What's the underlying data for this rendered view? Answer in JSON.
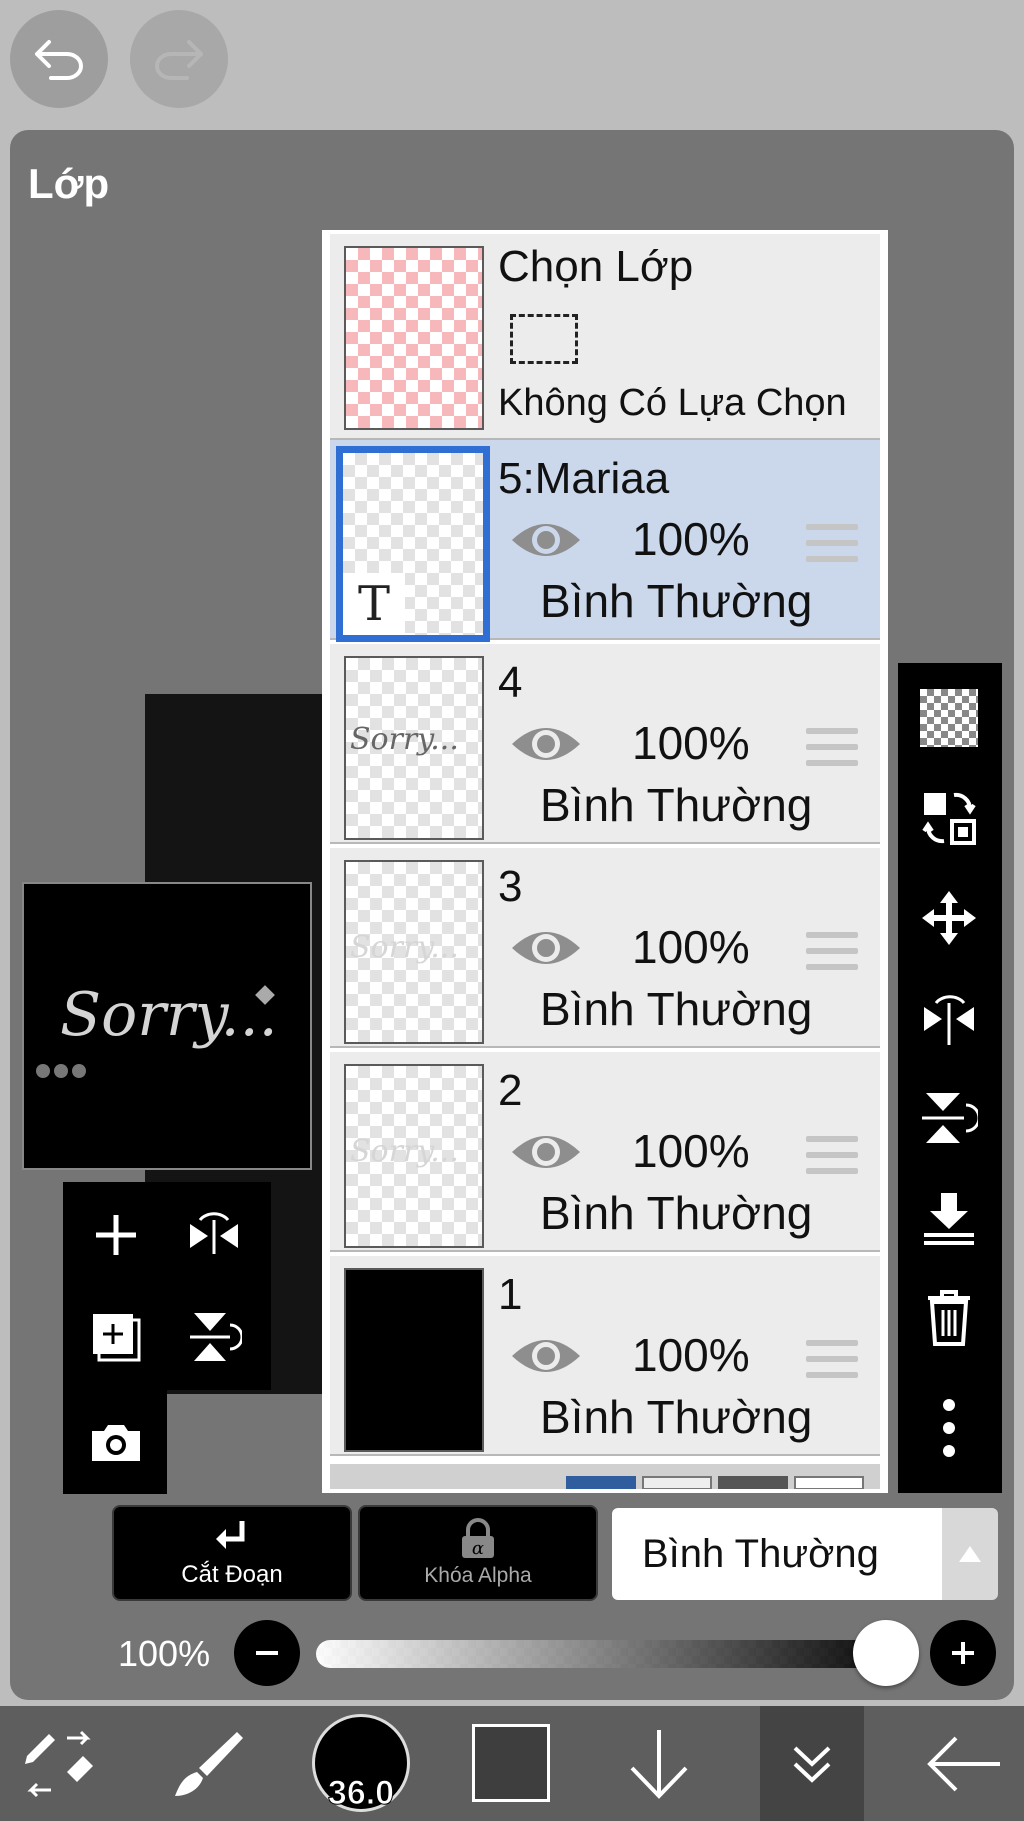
{
  "top": {
    "undo_icon": "undo-icon",
    "redo_icon": "redo-icon"
  },
  "panel": {
    "title": "Lớp"
  },
  "selection_layer": {
    "title": "Chọn Lớp",
    "subtitle": "Không Có Lựa Chọn"
  },
  "layers": [
    {
      "name": "5:Mariaa",
      "opacity": "100%",
      "blend": "Bình Thường",
      "selected": true
    },
    {
      "name": "4",
      "opacity": "100%",
      "blend": "Bình Thường",
      "selected": false
    },
    {
      "name": "3",
      "opacity": "100%",
      "blend": "Bình Thường",
      "selected": false
    },
    {
      "name": "2",
      "opacity": "100%",
      "blend": "Bình Thường",
      "selected": false
    },
    {
      "name": "1",
      "opacity": "100%",
      "blend": "Bình Thường",
      "selected": false
    }
  ],
  "thumbnails": {
    "text_layer_mark": "T",
    "sorry_text": "Sorry..."
  },
  "actions": {
    "clipping_label": "Cắt Đoạn",
    "alpha_lock_label": "Khóa Alpha",
    "blend_mode": "Bình Thường"
  },
  "opacity_slider": {
    "label": "100%",
    "value": 1.0
  },
  "bottom_bar": {
    "brush_size": "36.0"
  },
  "colors": {
    "panel_bg": "#757575",
    "selected_row": "#cbd7ea",
    "selection_border": "#2f6fd3",
    "selection_thumb": "#f7b8bb"
  }
}
